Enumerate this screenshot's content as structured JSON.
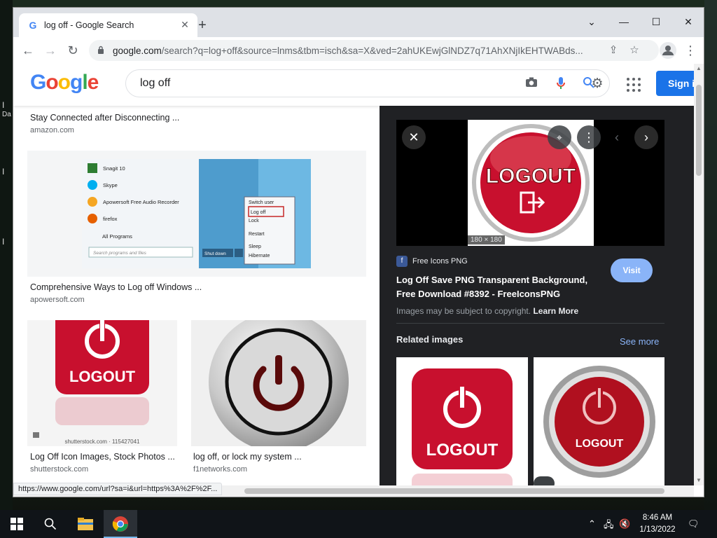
{
  "browser": {
    "tab_title": "log off - Google Search",
    "tab_favicon": "G",
    "url_host": "google.com",
    "url_path": "/search?q=log+off&source=lnms&tbm=isch&sa=X&ved=2ahUKEwjGlNDZ7q71AhXNjIkEHTWABds...",
    "status_url": "https://www.google.com/url?sa=i&url=https%3A%2F%2F..."
  },
  "google": {
    "logo_letters": [
      "G",
      "o",
      "o",
      "g",
      "l",
      "e"
    ],
    "search_value": "log off",
    "signin_label": "Sign i"
  },
  "results": {
    "top_caption": "Stay Connected after Disconnecting ...",
    "top_source": "amazon.com",
    "r1": {
      "caption": "Comprehensive Ways to Log off Windows ...",
      "source": "apowersoft.com",
      "menu_items": [
        "Snagit 10",
        "Skype",
        "Apowersoft Free Audio Recorder",
        "firefox",
        "All Programs"
      ],
      "search_placeholder": "Search programs and files",
      "shutdown_label": "Shut down",
      "power_menu": [
        "Switch user",
        "Log off",
        "Lock",
        "Restart",
        "Sleep",
        "Hibernate"
      ]
    },
    "r2": {
      "caption": "Log Off Icon Images, Stock Photos ...",
      "source": "shutterstock.com",
      "image_text": "LOGOUT",
      "watermark": "shutterstock.com · 115427041"
    },
    "r3": {
      "caption": "log off, or lock my system ...",
      "source": "f1networks.com"
    }
  },
  "preview": {
    "image_text": "LOGOUT",
    "dimensions": "180 × 180",
    "source_name": "Free Icons PNG",
    "title": "Log Off Save PNG Transparent Background, Free Download #8392 - FreeIconsPNG",
    "visit_label": "Visit",
    "copyright_text": "Images may be subject to copyright.",
    "learn_more": "Learn More",
    "related_label": "Related images",
    "see_more": "See more",
    "related": [
      {
        "image_text": "LOGOUT"
      },
      {
        "image_text": "LOGOUT"
      }
    ]
  },
  "taskbar": {
    "time": "8:46 AM",
    "date": "1/13/2022"
  },
  "colors": {
    "accent": "#1a73e8",
    "logout_red": "#c8102e",
    "preview_bg": "#202124"
  }
}
